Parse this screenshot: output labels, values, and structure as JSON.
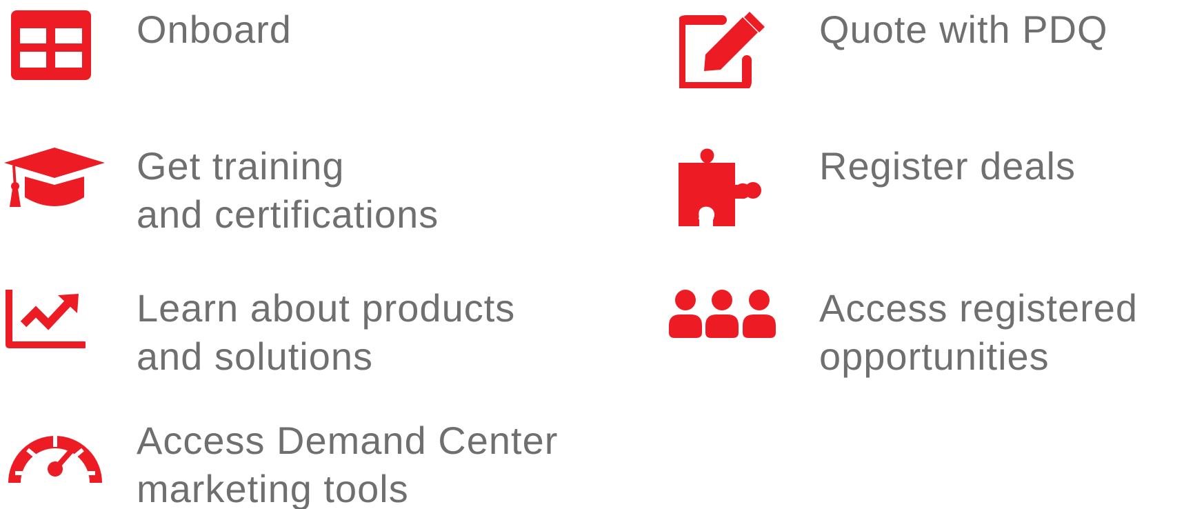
{
  "accent_color": "#ed1c24",
  "text_color": "#6f6f6f",
  "items": [
    {
      "icon": "grid-table-icon",
      "lines": [
        "Onboard"
      ]
    },
    {
      "icon": "edit-pencil-icon",
      "lines": [
        "Quote with PDQ"
      ]
    },
    {
      "icon": "graduation-cap-icon",
      "lines": [
        "Get training",
        "and certifications"
      ]
    },
    {
      "icon": "puzzle-piece-icon",
      "lines": [
        "Register deals"
      ]
    },
    {
      "icon": "trending-chart-icon",
      "lines": [
        "Learn about products",
        "and solutions"
      ]
    },
    {
      "icon": "people-group-icon",
      "lines": [
        "Access registered",
        "opportunities"
      ]
    },
    {
      "icon": "speedometer-icon",
      "lines": [
        "Access Demand Center",
        "marketing tools"
      ]
    }
  ]
}
